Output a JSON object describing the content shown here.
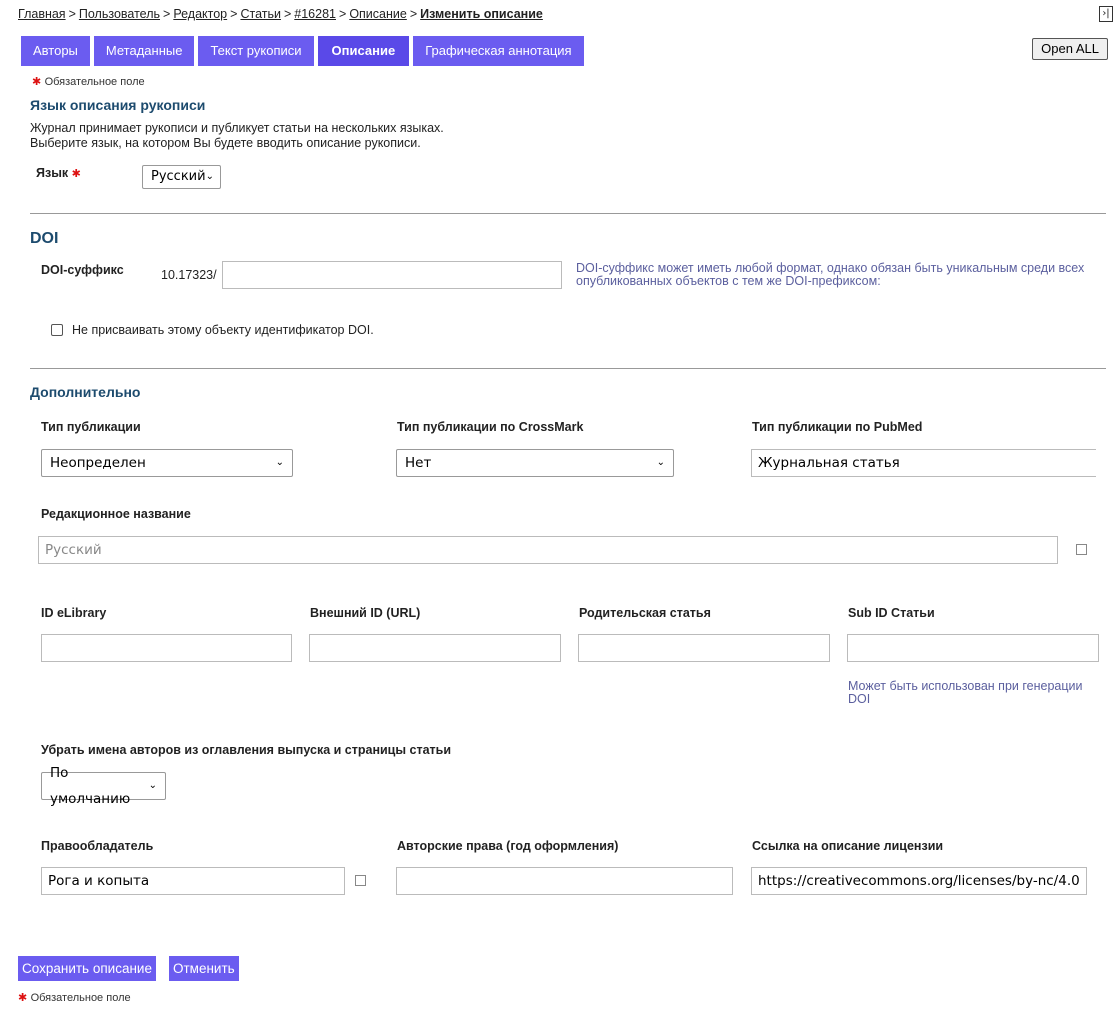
{
  "breadcrumb": {
    "home": "Главная",
    "user": "Пользователь",
    "editor": "Редактор",
    "articles": "Статьи",
    "article_id": "#16281",
    "description": "Описание",
    "current": "Изменить описание"
  },
  "collapse_icon": "›|",
  "tabs": [
    {
      "label": "Авторы"
    },
    {
      "label": "Метаданные"
    },
    {
      "label": "Текст рукописи"
    },
    {
      "label": "Описание",
      "active": true
    },
    {
      "label": "Графическая аннотация"
    }
  ],
  "open_all": "Open ALL",
  "required_note": "Обязательное поле",
  "language_section": {
    "title": "Язык описания рукописи",
    "line1": "Журнал принимает рукописи и публикует статьи на нескольких языках.",
    "line2": "Выберите язык, на котором Вы будете вводить описание рукописи.",
    "label": "Язык",
    "value": "Русский"
  },
  "doi": {
    "title": "DOI",
    "suffix_label": "DOI-суффикс",
    "prefix": "10.17323/",
    "suffix_value": "",
    "hint": "DOI-суффикс может иметь любой формат, однако обязан быть уникальным среди всех опубликованных объектов с тем же DOI-префиксом:",
    "no_doi_label": "Не присваивать этому объекту идентификатор DOI."
  },
  "additional": {
    "title": "Дополнительно",
    "pub_type_label": "Тип публикации",
    "pub_type_value": "Неопределен",
    "crossmark_label": "Тип публикации по CrossMark",
    "crossmark_value": "Нет",
    "pubmed_label": "Тип публикации по PubMed",
    "pubmed_value": "Журнальная статья",
    "editorial_title_label": "Редакционное название",
    "editorial_title_placeholder": "Русский",
    "elibrary_label": "ID eLibrary",
    "external_id_label": "Внешний ID (URL)",
    "parent_article_label": "Родительская статья",
    "sub_id_label": "Sub ID Статьи",
    "sub_id_hint": "Может быть использован при генерации DOI",
    "hide_authors_label": "Убрать имена авторов из оглавления выпуска и страницы статьи",
    "hide_authors_value": "По умолчанию",
    "copyright_holder_label": "Правообладатель",
    "copyright_holder_value": "Рога и копыта",
    "copyright_year_label": "Авторские права (год оформления)",
    "copyright_year_value": "",
    "license_url_label": "Ссылка на описание лицензии",
    "license_url_value": "https://creativecommons.org/licenses/by-nc/4.0"
  },
  "buttons": {
    "save": "Сохранить описание",
    "cancel": "Отменить"
  },
  "colors": {
    "tab_bg": "#6b5cf0",
    "heading": "#1d4b6e",
    "hint": "#5b5f9e",
    "required": "#dd1111"
  }
}
